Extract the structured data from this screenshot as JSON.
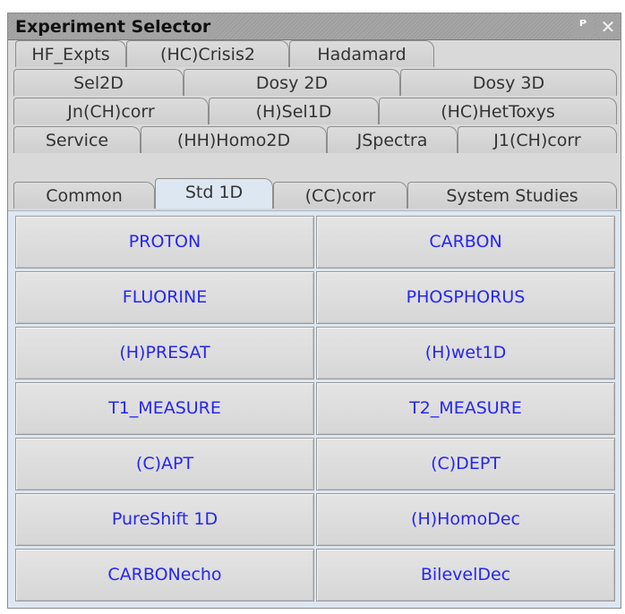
{
  "window": {
    "title": "Experiment Selector",
    "pin_glyph": "ᵖ",
    "close_glyph": "×"
  },
  "tabs": {
    "row1": [
      "HF_Expts",
      "(HC)Crisis2",
      "Hadamard"
    ],
    "row2": [
      "Sel2D",
      "Dosy 2D",
      "Dosy 3D"
    ],
    "row3": [
      "Jn(CH)corr",
      "(H)Sel1D",
      "(HC)HetToxys"
    ],
    "row4": [
      "Service",
      "(HH)Homo2D",
      "JSpectra",
      "J1(CH)corr"
    ],
    "row5": [
      "Common",
      "Std 1D",
      "(CC)corr",
      "System Studies"
    ],
    "active": "Std 1D"
  },
  "buttons": [
    [
      "PROTON",
      "CARBON"
    ],
    [
      "FLUORINE",
      "PHOSPHORUS"
    ],
    [
      "(H)PRESAT",
      "(H)wet1D"
    ],
    [
      "T1_MEASURE",
      "T2_MEASURE"
    ],
    [
      "(C)APT",
      "(C)DEPT"
    ],
    [
      "PureShift 1D",
      "(H)HomoDec"
    ],
    [
      "CARBONecho",
      "BilevelDec"
    ]
  ],
  "colors": {
    "button_text": "#2626f0",
    "active_tab": "#dde7f2",
    "panel_bg": "#d9d9d9"
  }
}
